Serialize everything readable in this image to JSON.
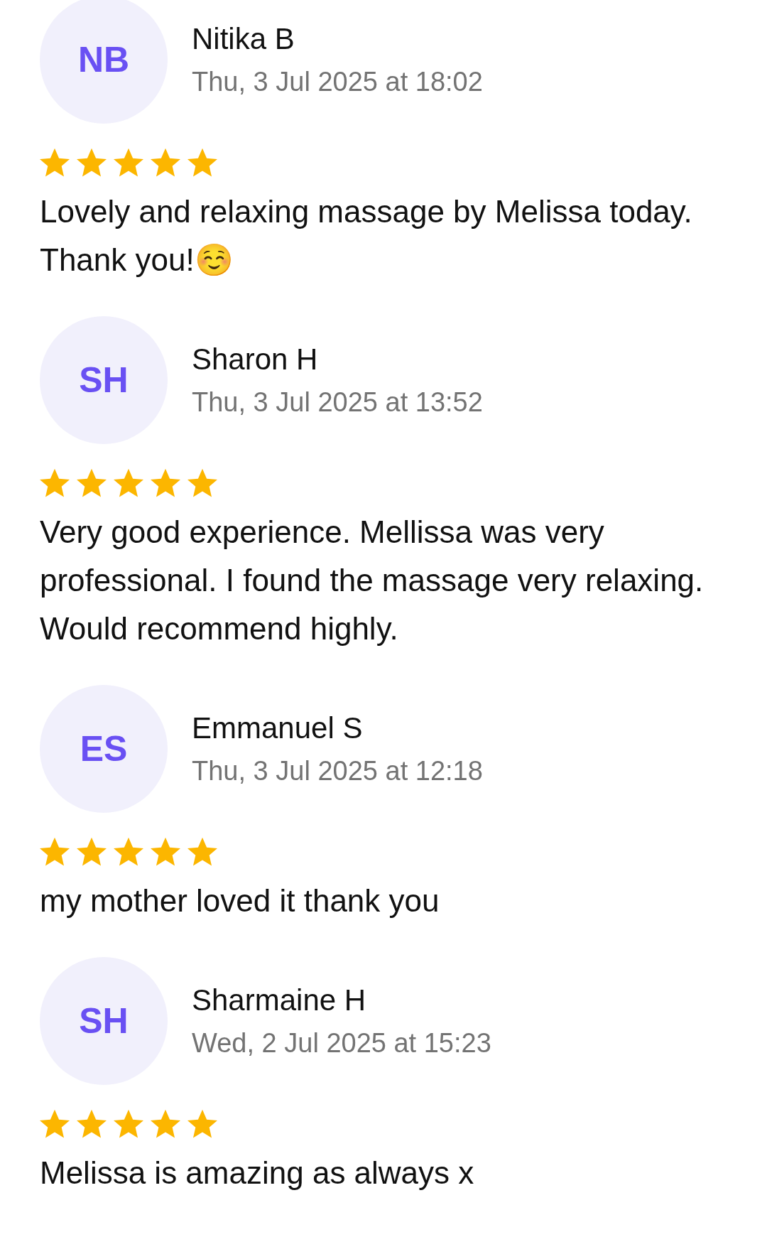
{
  "reviews": [
    {
      "initials": "NB",
      "name": "Nitika B",
      "date": "Thu, 3 Jul 2025 at 18:02",
      "stars": 5,
      "text": "Lovely and relaxing massage by Melissa today. Thank you!☺️"
    },
    {
      "initials": "SH",
      "name": "Sharon H",
      "date": "Thu, 3 Jul 2025 at 13:52",
      "stars": 5,
      "text": "Very good experience. Mellissa was very professional. I found the massage very relaxing. Would recommend highly."
    },
    {
      "initials": "ES",
      "name": "Emmanuel S",
      "date": "Thu, 3 Jul 2025 at 12:18",
      "stars": 5,
      "text": "my mother loved it thank you"
    },
    {
      "initials": "SH",
      "name": "Sharmaine H",
      "date": "Wed, 2 Jul 2025 at 15:23",
      "stars": 5,
      "text": "Melissa is amazing as always x"
    }
  ]
}
